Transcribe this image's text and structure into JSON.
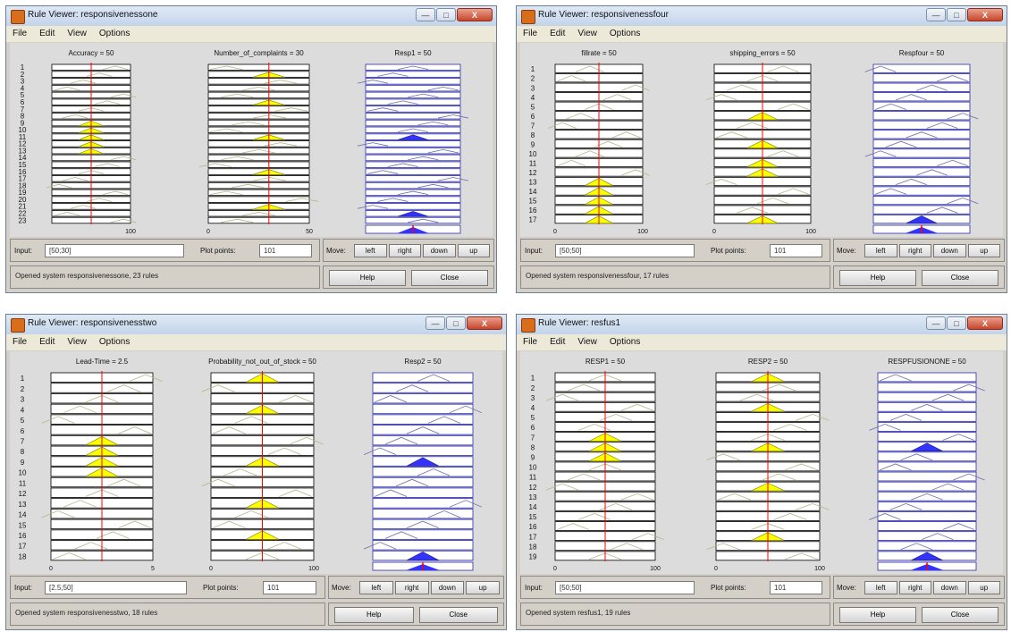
{
  "menus": [
    "File",
    "Edit",
    "View",
    "Options"
  ],
  "window_controls": {
    "minimize": "—",
    "maximize": "□",
    "close": "X"
  },
  "labels": {
    "input": "Input:",
    "plot_points": "Plot points:",
    "move": "Move:",
    "left": "left",
    "right": "right",
    "down": "down",
    "up": "up",
    "help": "Help",
    "close": "Close"
  },
  "colors": {
    "selected_fill": "#ffff00",
    "output_fill": "#3333ff",
    "threshold_line": "#ff0000",
    "mf_line_inactive": "#b5b589",
    "output_mf_line": "#6a6ab0",
    "window_bg": "#d4d0c8"
  },
  "windows": [
    {
      "title": "Rule Viewer: responsivenessone",
      "rules": 23,
      "inputs": [
        {
          "label": "Accuracy = 50",
          "axis_min": "",
          "axis_max": "100",
          "value_frac": 0.5,
          "active_rules": [
            9,
            10,
            11,
            12,
            13
          ]
        },
        {
          "label": "Number_of_complaints = 30",
          "axis_min": "0",
          "axis_max": "50",
          "value_frac": 0.6,
          "active_rules": [
            2,
            6,
            11,
            16,
            21
          ]
        }
      ],
      "output": {
        "label": "Resp1 = 50",
        "active_rules": [
          11,
          22
        ]
      },
      "input_value": "[50;30]",
      "plot_points": "101",
      "status": "Opened system responsivenessone, 23 rules"
    },
    {
      "title": "Rule Viewer: responsivenessfour",
      "rules": 17,
      "inputs": [
        {
          "label": "fillrate = 50",
          "axis_min": "0",
          "axis_max": "100",
          "value_frac": 0.5,
          "active_rules": [
            13,
            14,
            15,
            16,
            17
          ]
        },
        {
          "label": "shipping_errors = 50",
          "axis_min": "0",
          "axis_max": "100",
          "value_frac": 0.5,
          "active_rules": [
            6,
            9,
            11,
            12,
            17
          ]
        }
      ],
      "output": {
        "label": "Respfour = 50",
        "active_rules": [
          17
        ]
      },
      "input_value": "[50;50]",
      "plot_points": "101",
      "status": "Opened system responsivenessfour, 17 rules"
    },
    {
      "title": "Rule Viewer: responsivenesstwo",
      "rules": 18,
      "inputs": [
        {
          "label": "Lead-Time = 2.5",
          "axis_min": "0",
          "axis_max": "5",
          "value_frac": 0.5,
          "active_rules": [
            7,
            8,
            9,
            10
          ]
        },
        {
          "label": "Probability_not_out_of_stock = 50",
          "axis_min": "0",
          "axis_max": "100",
          "value_frac": 0.5,
          "active_rules": [
            1,
            4,
            9,
            13,
            16
          ]
        }
      ],
      "output": {
        "label": "Resp2 = 50",
        "active_rules": [
          9,
          18
        ]
      },
      "input_value": "[2.5;50]",
      "plot_points": "101",
      "status": "Opened system responsivenesstwo, 18 rules"
    },
    {
      "title": "Rule Viewer: resfus1",
      "rules": 19,
      "inputs": [
        {
          "label": "RESP1 = 50",
          "axis_min": "0",
          "axis_max": "100",
          "value_frac": 0.5,
          "active_rules": [
            7,
            8,
            9
          ]
        },
        {
          "label": "RESP2 = 50",
          "axis_min": "0",
          "axis_max": "100",
          "value_frac": 0.5,
          "active_rules": [
            1,
            4,
            8,
            12,
            17
          ]
        }
      ],
      "output": {
        "label": "RESPFUSIONONE = 50",
        "active_rules": [
          8,
          19
        ]
      },
      "input_value": "[50;50]",
      "plot_points": "101",
      "status": "Opened system resfus1, 19 rules"
    }
  ]
}
